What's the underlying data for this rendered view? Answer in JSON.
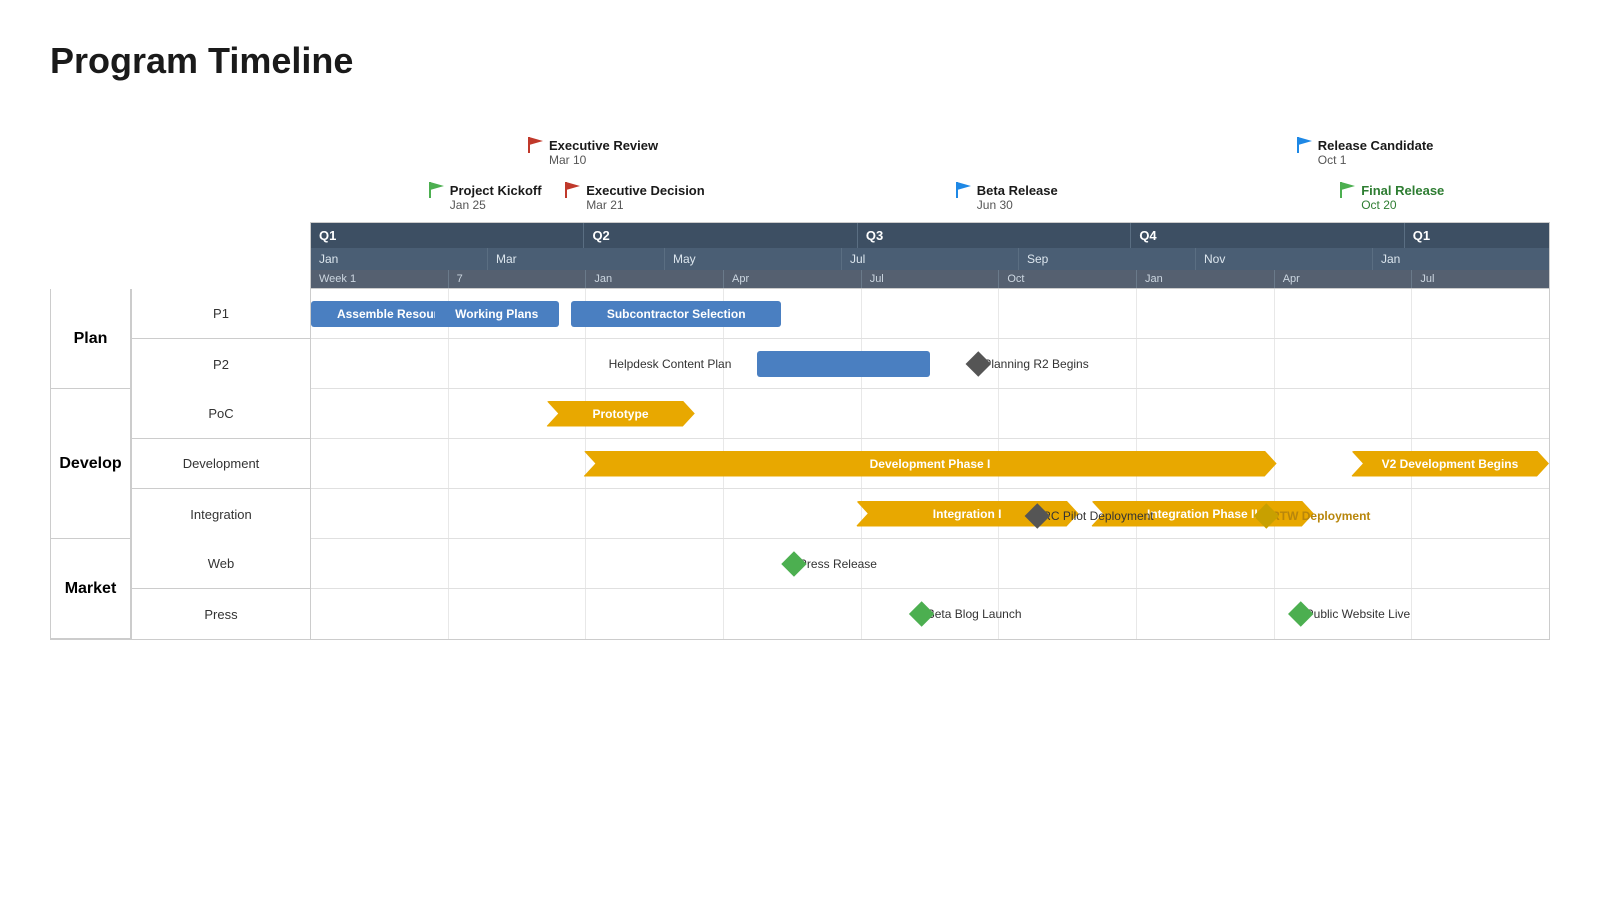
{
  "title": "Program Timeline",
  "milestones": [
    {
      "id": "project-kickoff",
      "label": "Project Kickoff",
      "date": "Jan 25",
      "flagColor": "green",
      "pct": 9.5,
      "row": 1
    },
    {
      "id": "executive-review",
      "label": "Executive Review",
      "date": "Mar 10",
      "flagColor": "red",
      "pct": 17.5,
      "row": 0
    },
    {
      "id": "executive-decision",
      "label": "Executive Decision",
      "date": "Mar 21",
      "flagColor": "red",
      "pct": 20.5,
      "row": 1
    },
    {
      "id": "beta-release",
      "label": "Beta Release",
      "date": "Jun 30",
      "flagColor": "blue",
      "pct": 52.0,
      "row": 1
    },
    {
      "id": "release-candidate",
      "label": "Release Candidate",
      "date": "Oct 1",
      "flagColor": "blue",
      "pct": 79.5,
      "row": 0
    },
    {
      "id": "final-release",
      "label": "Final Release",
      "date": "Oct 20",
      "flagColor": "green",
      "pct": 83.0,
      "row": 1,
      "green": true
    }
  ],
  "header": {
    "quarters": [
      "Q1",
      "Q2",
      "Q3",
      "Q4",
      "Q1"
    ],
    "months": [
      "Jan",
      "Mar",
      "May",
      "Jul",
      "Sep",
      "Nov",
      "Jan"
    ],
    "weeks": [
      "Week 1",
      "7",
      "Jan",
      "Apr",
      "Jul",
      "Oct",
      "Jan",
      "Apr",
      "Jul"
    ]
  },
  "groups": [
    {
      "id": "plan",
      "label": "Plan",
      "color": "plan",
      "rows": [
        {
          "id": "p1",
          "label": "P1",
          "bars": [
            {
              "label": "Assemble Resources",
              "start": 0,
              "width": 14,
              "type": "blue"
            },
            {
              "label": "Working Plans",
              "start": 10,
              "width": 10,
              "type": "blue"
            },
            {
              "label": "Subcontractor Selection",
              "start": 21,
              "width": 17,
              "type": "blue"
            }
          ]
        },
        {
          "id": "p2",
          "label": "P2",
          "bars": [
            {
              "label": "Helpdesk Content Plan",
              "start": 24,
              "width": 10,
              "type": "text-only"
            },
            {
              "label": "",
              "start": 36,
              "width": 14,
              "type": "blue"
            }
          ],
          "diamonds": [
            {
              "label": "Planning R2 Begins",
              "pos": 58,
              "color": "dark"
            }
          ]
        }
      ]
    },
    {
      "id": "develop",
      "label": "Develop",
      "color": "develop",
      "rows": [
        {
          "id": "poc",
          "label": "PoC",
          "bars": [
            {
              "label": "Prototype",
              "start": 19,
              "width": 12,
              "type": "gold-arrow"
            }
          ]
        },
        {
          "id": "development",
          "label": "Development",
          "bars": [
            {
              "label": "Development Phase I",
              "start": 22,
              "width": 56,
              "type": "gold-arrow"
            }
          ],
          "extra": [
            {
              "label": "V2 Development Begins",
              "start": 84,
              "width": 16,
              "type": "gold-arrow-end"
            }
          ]
        },
        {
          "id": "integration",
          "label": "Integration",
          "bars": [
            {
              "label": "Integration I",
              "start": 44,
              "width": 18,
              "type": "gold-arrow"
            },
            {
              "label": "Integration Phase II",
              "start": 63,
              "width": 18,
              "type": "gold-arrow"
            }
          ],
          "diamonds": [
            {
              "label": "RC Pilot Deployment",
              "pos": 63,
              "color": "dark",
              "below": true
            },
            {
              "label": "RTW Deployment",
              "pos": 81,
              "color": "gold",
              "below": true
            }
          ]
        }
      ]
    },
    {
      "id": "market",
      "label": "Market",
      "color": "market",
      "rows": [
        {
          "id": "web",
          "label": "Web",
          "diamonds": [
            {
              "label": "Press Release",
              "pos": 42,
              "color": "green"
            }
          ]
        },
        {
          "id": "press",
          "label": "Press",
          "diamonds": [
            {
              "label": "Beta Blog Launch",
              "pos": 53,
              "color": "green"
            },
            {
              "label": "Public Website Live",
              "pos": 84,
              "color": "green"
            }
          ]
        }
      ]
    }
  ]
}
